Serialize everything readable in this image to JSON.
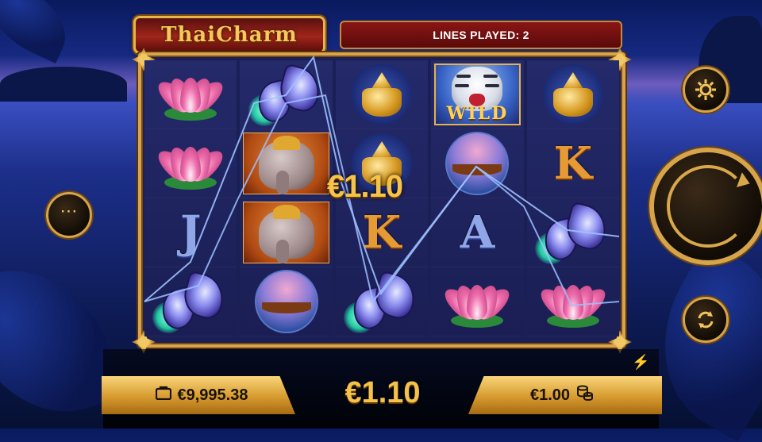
{
  "game": {
    "title": "ThaiCharm",
    "lines_played_label": "LINES PLAYED: 2",
    "win_overlay": "€1.10"
  },
  "reels": [
    [
      "lotus",
      "lotus",
      "J",
      "butterfly"
    ],
    [
      "butterfly",
      "elephant",
      "elephant",
      "boat"
    ],
    [
      "urn",
      "urn",
      "K",
      "butterfly"
    ],
    [
      "wild-tiger",
      "boat",
      "A",
      "lotus"
    ],
    [
      "urn",
      "K",
      "butterfly",
      "lotus"
    ]
  ],
  "wild_label": "WILD",
  "bottom": {
    "balance": "€9,995.38",
    "win": "€1.10",
    "bet": "€1.00"
  },
  "buttons": {
    "menu": "⋯",
    "settings_icon": "gear-icon",
    "spin_icon": "spin-arrow-icon",
    "autoplay_icon": "autoplay-icon"
  },
  "colors": {
    "gold": "#d9a54a",
    "red_banner": "#8a1515",
    "payline": "#8fb8ff"
  }
}
